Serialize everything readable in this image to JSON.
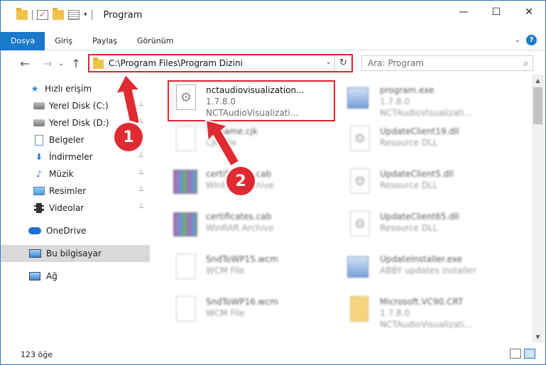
{
  "window": {
    "title": "Program",
    "minimize_glyph": "—",
    "maximize_glyph": "☐",
    "close_glyph": "✕"
  },
  "ribbon": {
    "tabs": [
      {
        "label": "Dosya",
        "active": true
      },
      {
        "label": "Giriş",
        "active": false
      },
      {
        "label": "Paylaş",
        "active": false
      },
      {
        "label": "Görünüm",
        "active": false
      }
    ],
    "help_glyph": "?",
    "expand_glyph": "⌄"
  },
  "nav": {
    "back_glyph": "←",
    "forward_glyph": "→",
    "recent_glyph": "⌄",
    "up_glyph": "↑",
    "address_path": "C:\\Program Files\\Program Dizini",
    "dropdown_glyph": "⌄",
    "refresh_glyph": "↻",
    "search_placeholder": "Ara: Program",
    "search_glyph": "⌕"
  },
  "sidebar": {
    "items": [
      {
        "label": "Hızlı erişim",
        "icon": "star-icon",
        "pinned": false
      },
      {
        "label": "Yerel Disk (C:)",
        "icon": "drive-icon",
        "pinned": true
      },
      {
        "label": "Yerel Disk (D:)",
        "icon": "drive-icon",
        "pinned": true
      },
      {
        "label": "Belgeler",
        "icon": "documents-icon",
        "pinned": true
      },
      {
        "label": "İndirmeler",
        "icon": "downloads-icon",
        "pinned": true
      },
      {
        "label": "Müzik",
        "icon": "music-icon",
        "pinned": true
      },
      {
        "label": "Resimler",
        "icon": "pictures-icon",
        "pinned": true
      },
      {
        "label": "Videolar",
        "icon": "videos-icon",
        "pinned": true
      },
      {
        "label": "OneDrive",
        "icon": "onedrive-icon",
        "pinned": false
      },
      {
        "label": "Bu bilgisayar",
        "icon": "this-pc-icon",
        "pinned": false,
        "selected": true
      },
      {
        "label": "Ağ",
        "icon": "network-icon",
        "pinned": false
      }
    ],
    "pin_glyph": "📌"
  },
  "files": [
    {
      "name": "nctaudiovisualization...",
      "line2": "1.7.8.0",
      "line3": "NCTAudioVisualizati...",
      "icon": "gear-file-icon",
      "highlighted": true
    },
    {
      "name": "program.exe",
      "line2": "1.7.8.0",
      "line3": "NCTAudioVisualizati...",
      "icon": "exe-icon"
    },
    {
      "name": "filename.cjk",
      "line2": "CJK File",
      "icon": "file-icon"
    },
    {
      "name": "UpdateClient19.dll",
      "line2": "Resource DLL",
      "icon": "dll-icon"
    },
    {
      "name": "certificates.cab",
      "line2": "WinRAR Archive",
      "icon": "rar-icon"
    },
    {
      "name": "UpdateClient5.dll",
      "line2": "Resource DLL",
      "icon": "dll-icon"
    },
    {
      "name": "certificates.cab",
      "line2": "WinRAR Archive",
      "icon": "rar-icon"
    },
    {
      "name": "UpdateClient65.dll",
      "line2": "Resource DLL",
      "icon": "dll-icon"
    },
    {
      "name": "SndToWP15.wcm",
      "line2": "WCM File",
      "icon": "file-icon"
    },
    {
      "name": "UpdateInstaller.exe",
      "line2": "ABBY updates installer",
      "icon": "exe-icon"
    },
    {
      "name": "SndToWP16.wcm",
      "line2": "WCM File",
      "icon": "file-icon"
    },
    {
      "name": "Microsoft.VC90.CRT",
      "line2": "1.7.8.0",
      "line3": "NCTAudioVisualizati...",
      "icon": "vc-icon"
    }
  ],
  "status": {
    "item_count": "123 öğe"
  },
  "annotations": {
    "step1": "1",
    "step2": "2",
    "color": "#e02a32"
  }
}
